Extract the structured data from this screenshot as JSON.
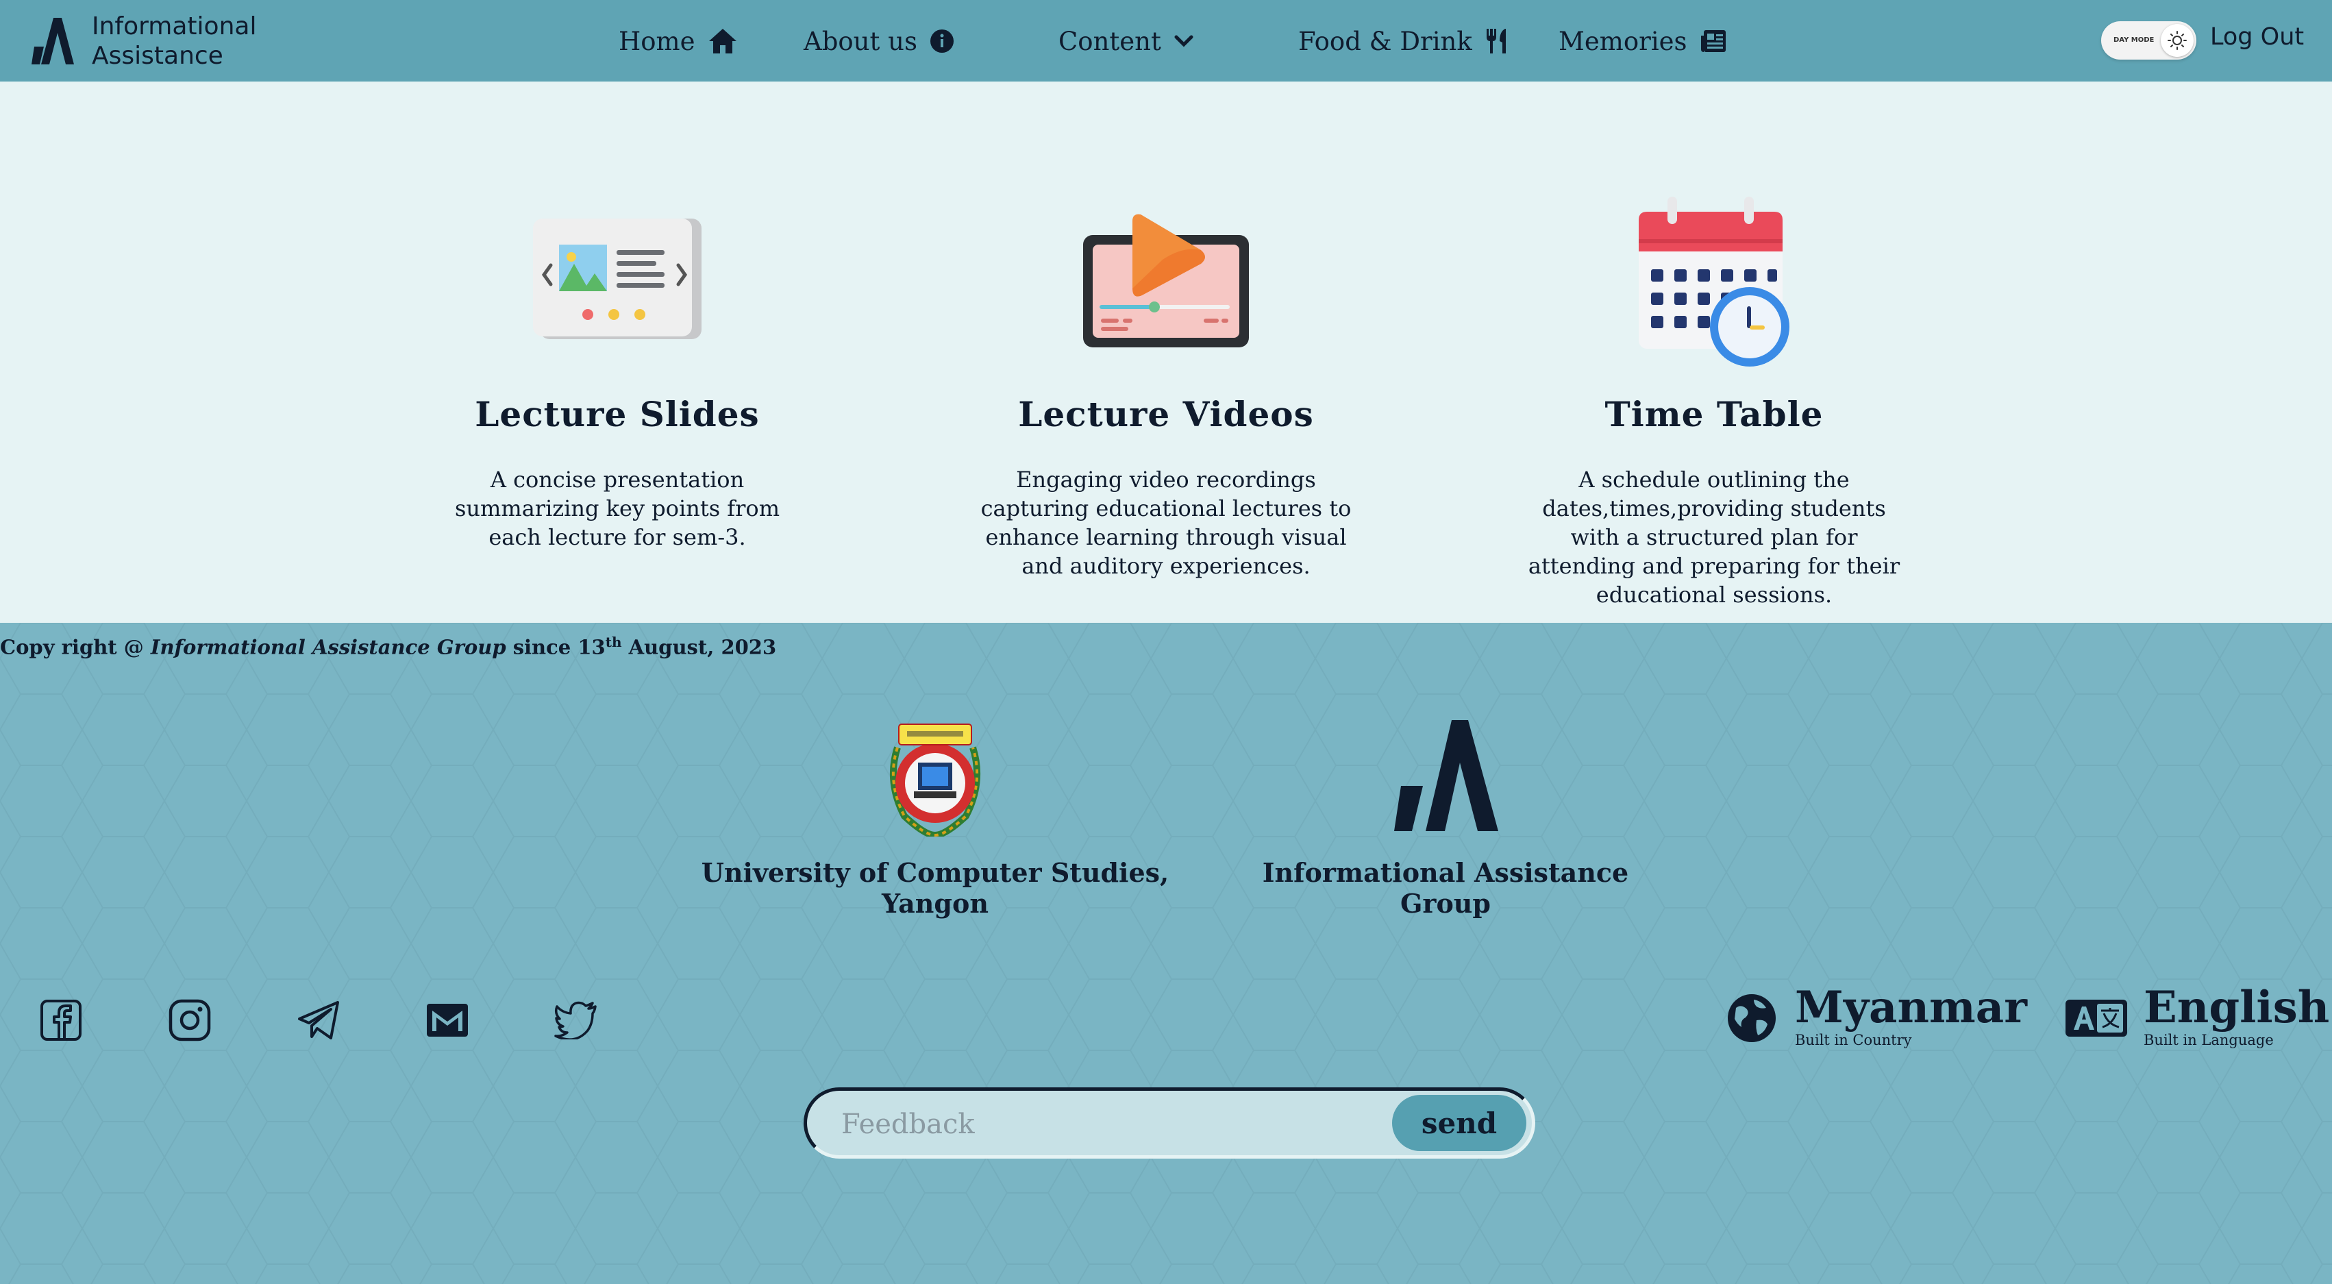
{
  "nav": {
    "brand_line1": "Informational",
    "brand_line2": "Assistance",
    "items": [
      {
        "label": "Home",
        "icon": "home-icon"
      },
      {
        "label": "About us",
        "icon": "info-icon"
      },
      {
        "label": "Content",
        "icon": "chevron-down-icon"
      },
      {
        "label": "Food & Drink",
        "icon": "utensils-icon"
      },
      {
        "label": "Memories",
        "icon": "newspaper-icon"
      }
    ],
    "toggle_label": "DAY MODE",
    "logout_label": "Log Out"
  },
  "cards": [
    {
      "title": "Lecture Slides",
      "description": "A concise presentation summarizing key points from each lecture for sem-3.",
      "icon": "slides-icon"
    },
    {
      "title": "Lecture Videos",
      "description": "Engaging video recordings capturing educational lectures to enhance learning through visual and auditory experiences.",
      "icon": "video-icon"
    },
    {
      "title": "Time Table",
      "description": "A schedule outlining the dates,times,providing students with a structured plan for attending and preparing for their educational sessions.",
      "icon": "calendar-clock-icon"
    }
  ],
  "footer": {
    "copyright_prefix": "Copy right @",
    "copyright_group": "Informational Assistance Group",
    "copyright_since": "since 13",
    "copyright_sup": "th",
    "copyright_date": "August, 2023",
    "org1": "University of Computer Studies, Yangon",
    "org2": "Informational Assistance Group",
    "social": [
      "facebook-icon",
      "instagram-icon",
      "telegram-icon",
      "mail-icon",
      "twitter-icon"
    ],
    "country": "Myanmar",
    "country_caption": "Built in Country",
    "language": "English",
    "language_caption": "Built in Language",
    "feedback_placeholder": "Feedback",
    "send_label": "send"
  },
  "colors": {
    "nav_bg": "#5fa4b4",
    "main_bg": "#e6f3f4",
    "footer_bg": "#7ab5c4",
    "text_dark": "#0f1b2d",
    "send_bg": "#56a0b1"
  }
}
